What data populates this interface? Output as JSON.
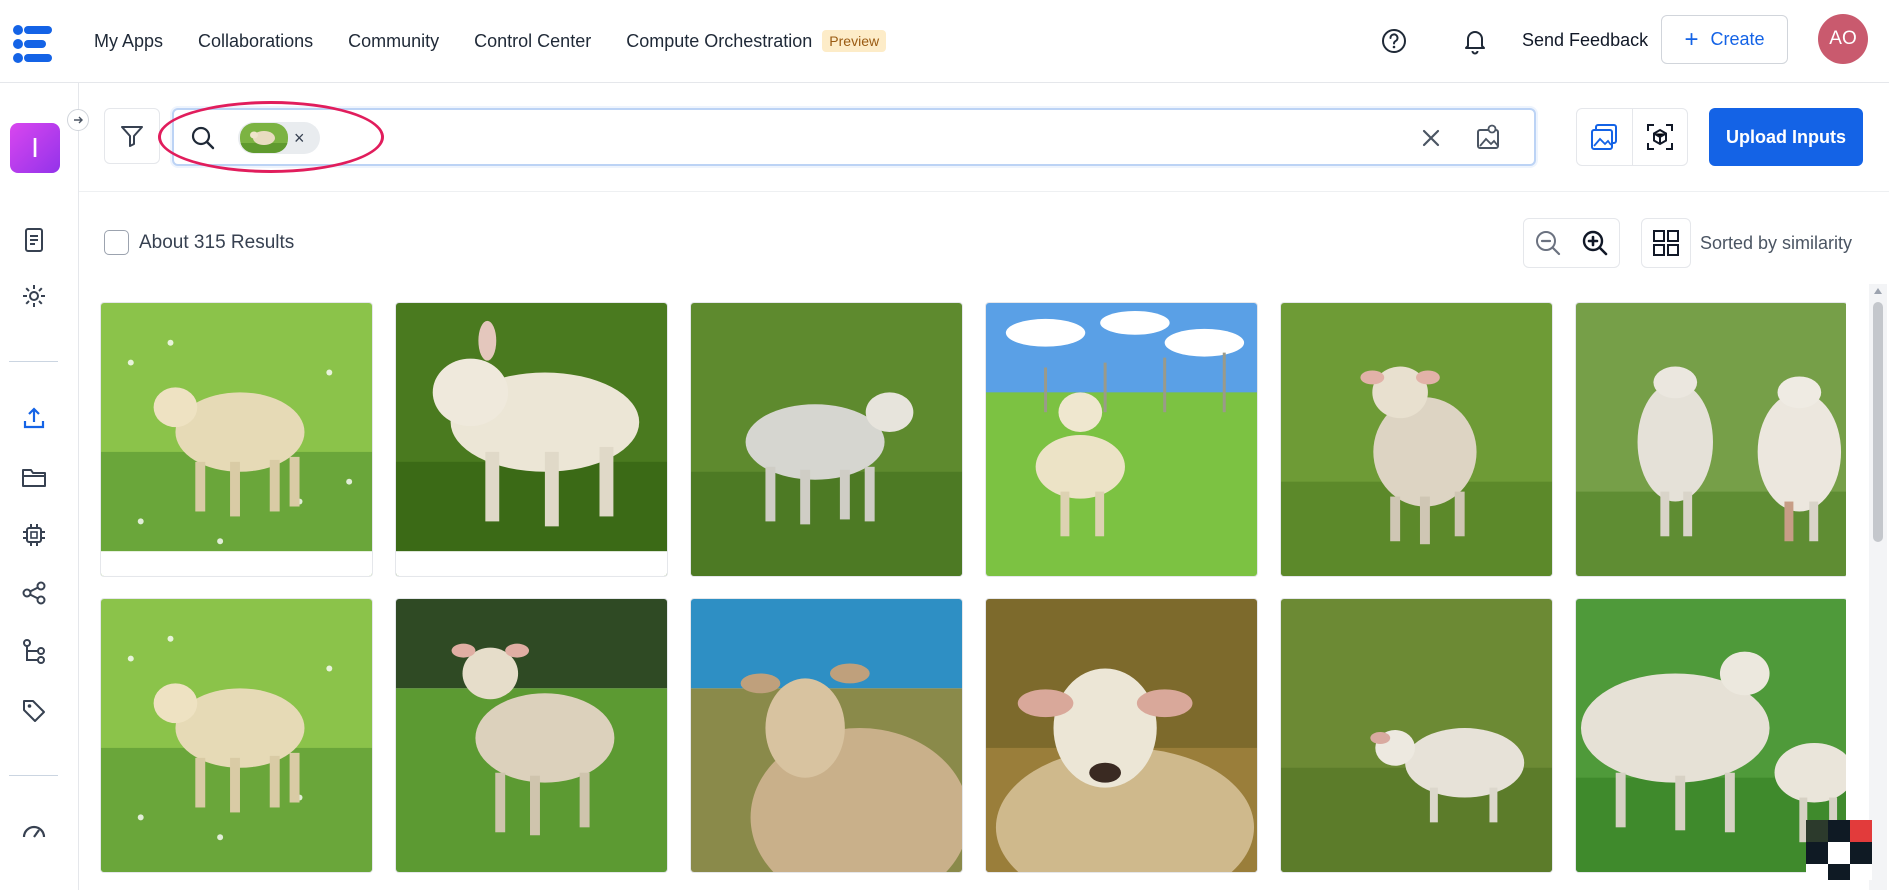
{
  "nav": {
    "items": [
      "My Apps",
      "Collaborations",
      "Community",
      "Control Center",
      "Compute Orchestration"
    ],
    "badge": "Preview",
    "send_feedback": "Send Feedback",
    "create_label": "Create",
    "create_symbol": "+",
    "avatar_initials": "AO"
  },
  "sidebar": {
    "app_initial": "I",
    "icons": [
      "document-icon",
      "gear-icon",
      "upload-icon",
      "folder-icon",
      "chip-icon",
      "share-icon",
      "workflow-icon",
      "tag-icon",
      "dashboard-icon"
    ]
  },
  "search": {
    "placeholder": "",
    "chip_close": "×",
    "annotation_color": "#e11d5c"
  },
  "upload_label": "Upload Inputs",
  "results": {
    "count_label": "About 315 Results",
    "sort_label": "Sorted by similarity"
  },
  "colors": {
    "accent": "#1463e6",
    "avatar_bg": "#c95a6e",
    "badge_bg": "#fdecc8"
  },
  "images": [
    "lamb-in-clover-meadow",
    "lamb-on-green-backdrop",
    "lamb-in-tall-grass",
    "lamb-blue-sky-fence",
    "lamb-walking-forward",
    "two-lambs-from-behind",
    "lamb-in-clover-meadow",
    "lamb-in-grass-trees",
    "sheep-portrait-sky",
    "sheep-face-closeup",
    "lamb-in-grass-distance",
    "sheep-and-lamb-in-field"
  ]
}
